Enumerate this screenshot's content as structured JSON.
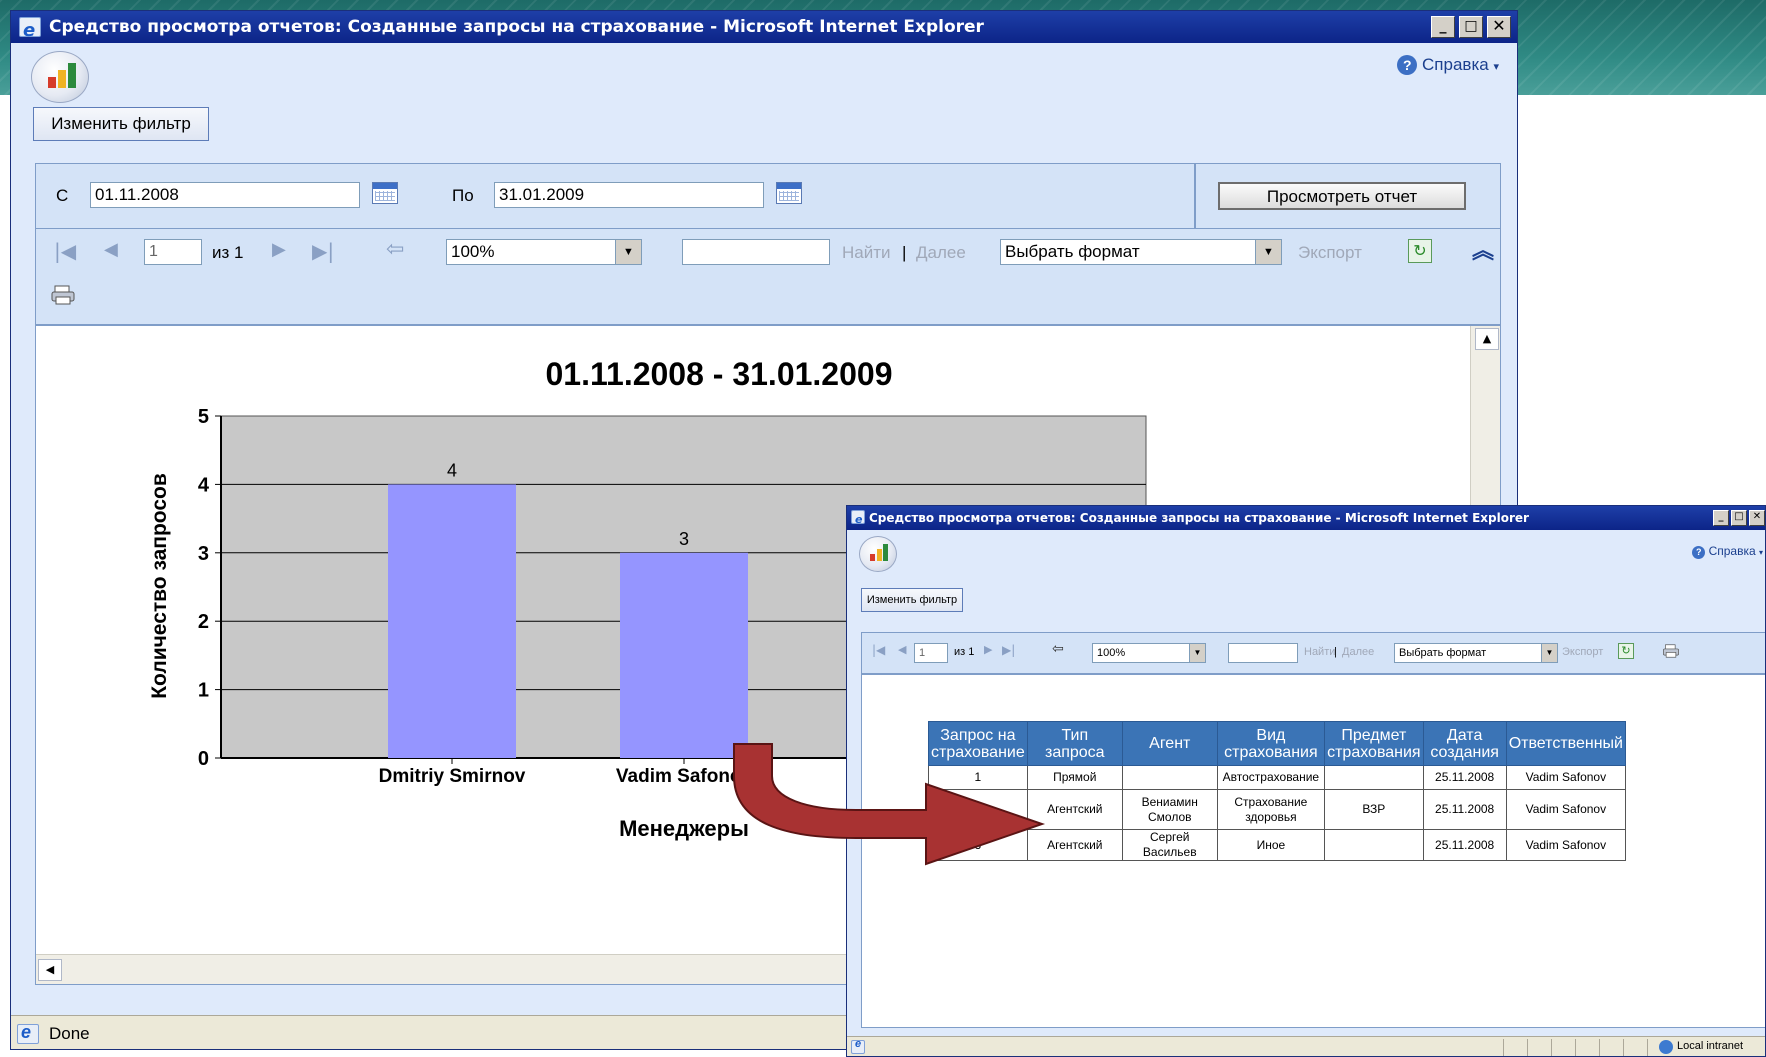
{
  "main_window": {
    "title": "Средство просмотра отчетов: Созданные запросы на страхование - Microsoft Internet Explorer",
    "help_label": "Справка",
    "change_filter_label": "Изменить фильтр",
    "from_label": "С",
    "from_value": "01.11.2008",
    "to_label": "По",
    "to_value": "31.01.2009",
    "view_report_label": "Просмотреть отчет",
    "page_current": "1",
    "page_of": "из 1",
    "zoom": "100%",
    "find_label": "Найти",
    "next_label": "Далее",
    "format_select": "Выбрать формат",
    "export_label": "Экспорт",
    "status_text": "Done"
  },
  "chart_data": {
    "type": "bar",
    "title": "01.11.2008 - 31.01.2009",
    "xlabel": "Менеджеры",
    "ylabel": "Количество запросов",
    "categories": [
      "Dmitriy Smirnov",
      "Vadim Safonov"
    ],
    "values": [
      4,
      3
    ],
    "data_labels": [
      "4",
      "3"
    ],
    "ylim": [
      0,
      5
    ],
    "yticks": [
      "0",
      "1",
      "2",
      "3",
      "4",
      "5"
    ],
    "grid": true,
    "bar_color": "#9595ff",
    "plot_bg": "#c8c8c8"
  },
  "second_window": {
    "title": "Средство просмотра отчетов: Созданные запросы на страхование - Microsoft Internet Explorer",
    "help_label": "Справка",
    "change_filter_label": "Изменить фильтр",
    "page_current": "1",
    "page_of": "из 1",
    "zoom": "100%",
    "find_label": "Найти",
    "next_label": "Далее",
    "format_select": "Выбрать формат",
    "export_label": "Экспорт",
    "status_zone": "Local intranet",
    "table": {
      "headers": [
        "Запрос на страхование",
        "Тип запроса",
        "Агент",
        "Вид страхования",
        "Предмет страхования",
        "Дата создания",
        "Ответственный"
      ],
      "rows": [
        [
          "1",
          "Прямой",
          "",
          "Автострахование",
          "",
          "25.11.2008",
          "Vadim Safonov"
        ],
        [
          "",
          "Агентский",
          "Вениамин Смолов",
          "Страхование здоровья",
          "ВЗР",
          "25.11.2008",
          "Vadim Safonov"
        ],
        [
          "3",
          "Агентский",
          "Сергей Васильев",
          "Иное",
          "",
          "25.11.2008",
          "Vadim Safonov"
        ]
      ]
    }
  },
  "colors": {
    "titlebar": "#0c2488",
    "window_bg": "#dfeafb",
    "panel": "#d4e3f7",
    "table_header": "#3b74b6",
    "arrow": "#a83232"
  }
}
